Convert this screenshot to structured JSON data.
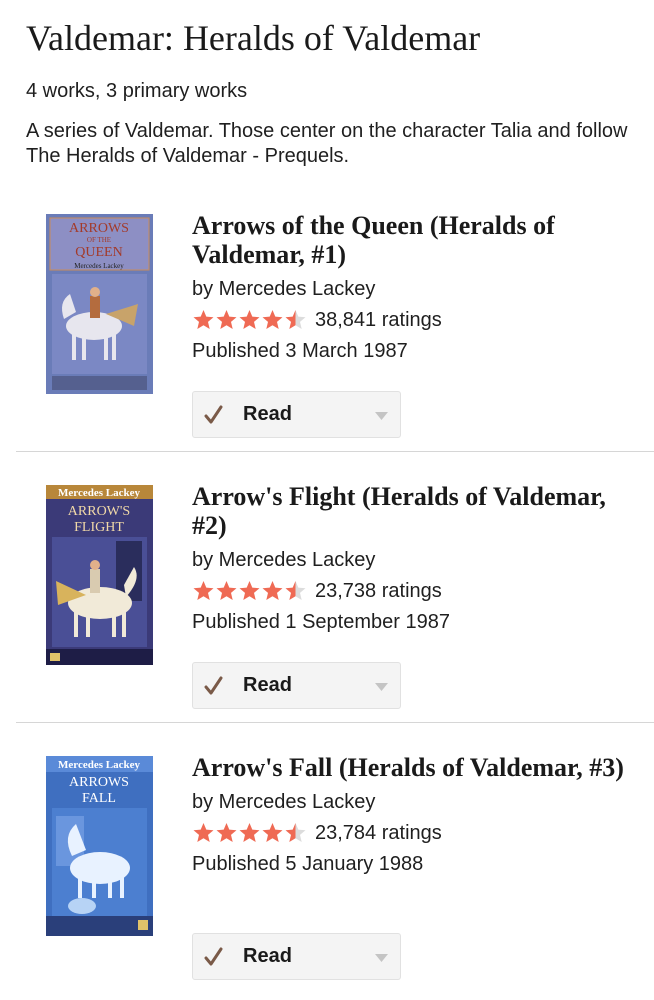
{
  "series": {
    "title": "Valdemar: Heralds of Valdemar",
    "works_count": "4 works, 3 primary works",
    "description": "A series of Valdemar. Those center on the character Talia and follow The Heralds of Valdemar - Prequels."
  },
  "colors": {
    "star_filled": "#ef6a54",
    "star_empty": "#dcdcdc",
    "check": "#7a5a48"
  },
  "books": [
    {
      "title": "Arrows of the Queen (Heralds of Valdemar, #1)",
      "author": "by Mercedes Lackey",
      "rating": 4.5,
      "ratings_count": "38,841 ratings",
      "published": "Published 3 March 1987",
      "shelf": "Read",
      "cover": {
        "line1": "ARROWS",
        "line2": "OF THE",
        "line3": "QUEEN",
        "author": "Mercedes Lackey",
        "bg": "#6a7cb8"
      }
    },
    {
      "title": "Arrow's Flight (Heralds of Valdemar, #2)",
      "author": "by Mercedes Lackey",
      "rating": 4.5,
      "ratings_count": "23,738 ratings",
      "published": "Published 1 September 1987",
      "shelf": "Read",
      "cover": {
        "line1": "Mercedes Lackey",
        "line2": "ARROW'S",
        "line3": "FLIGHT",
        "author": "",
        "bg": "#3b3a78"
      }
    },
    {
      "title": "Arrow's Fall (Heralds of Valdemar, #3)",
      "author": "by Mercedes Lackey",
      "rating": 4.5,
      "ratings_count": "23,784 ratings",
      "published": "Published 5 January 1988",
      "shelf": "Read",
      "cover": {
        "line1": "Mercedes Lackey",
        "line2": "ARROWS",
        "line3": "FALL",
        "author": "",
        "bg": "#3f6fc0"
      }
    }
  ]
}
